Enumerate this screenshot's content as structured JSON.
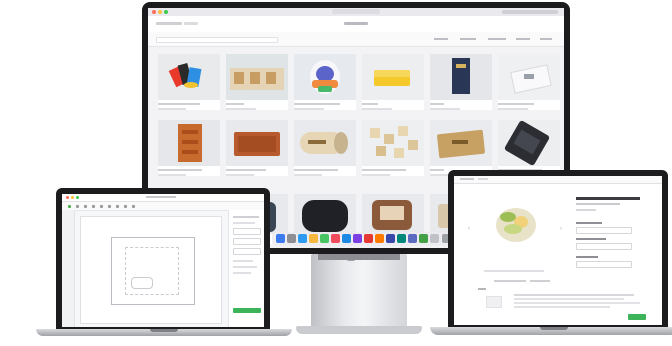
{
  "desktop": {
    "logo": "",
    "tagline": "",
    "nav": [
      "",
      "",
      "",
      "",
      "",
      "",
      ""
    ],
    "products": [
      {
        "caption": "",
        "sub": ""
      },
      {
        "caption": "",
        "sub": ""
      },
      {
        "caption": "",
        "sub": ""
      },
      {
        "caption": "",
        "sub": ""
      },
      {
        "caption": "",
        "sub": ""
      },
      {
        "caption": "",
        "sub": ""
      },
      {
        "caption": "",
        "sub": ""
      },
      {
        "caption": "",
        "sub": ""
      },
      {
        "caption": "",
        "sub": ""
      },
      {
        "caption": "",
        "sub": ""
      },
      {
        "caption": "",
        "sub": ""
      },
      {
        "caption": "",
        "sub": ""
      }
    ]
  },
  "laptop_left": {
    "app_title": "",
    "sidebar_button": ""
  },
  "laptop_right": {
    "product_title": "",
    "price": "",
    "option_label_1": "",
    "option_label_2": "",
    "quantity_label": "",
    "add_button": ""
  },
  "colors": {
    "accent_green": "#3db35a",
    "screen_bg": "#f3f3f5",
    "bezel": "#1b1b1d"
  }
}
